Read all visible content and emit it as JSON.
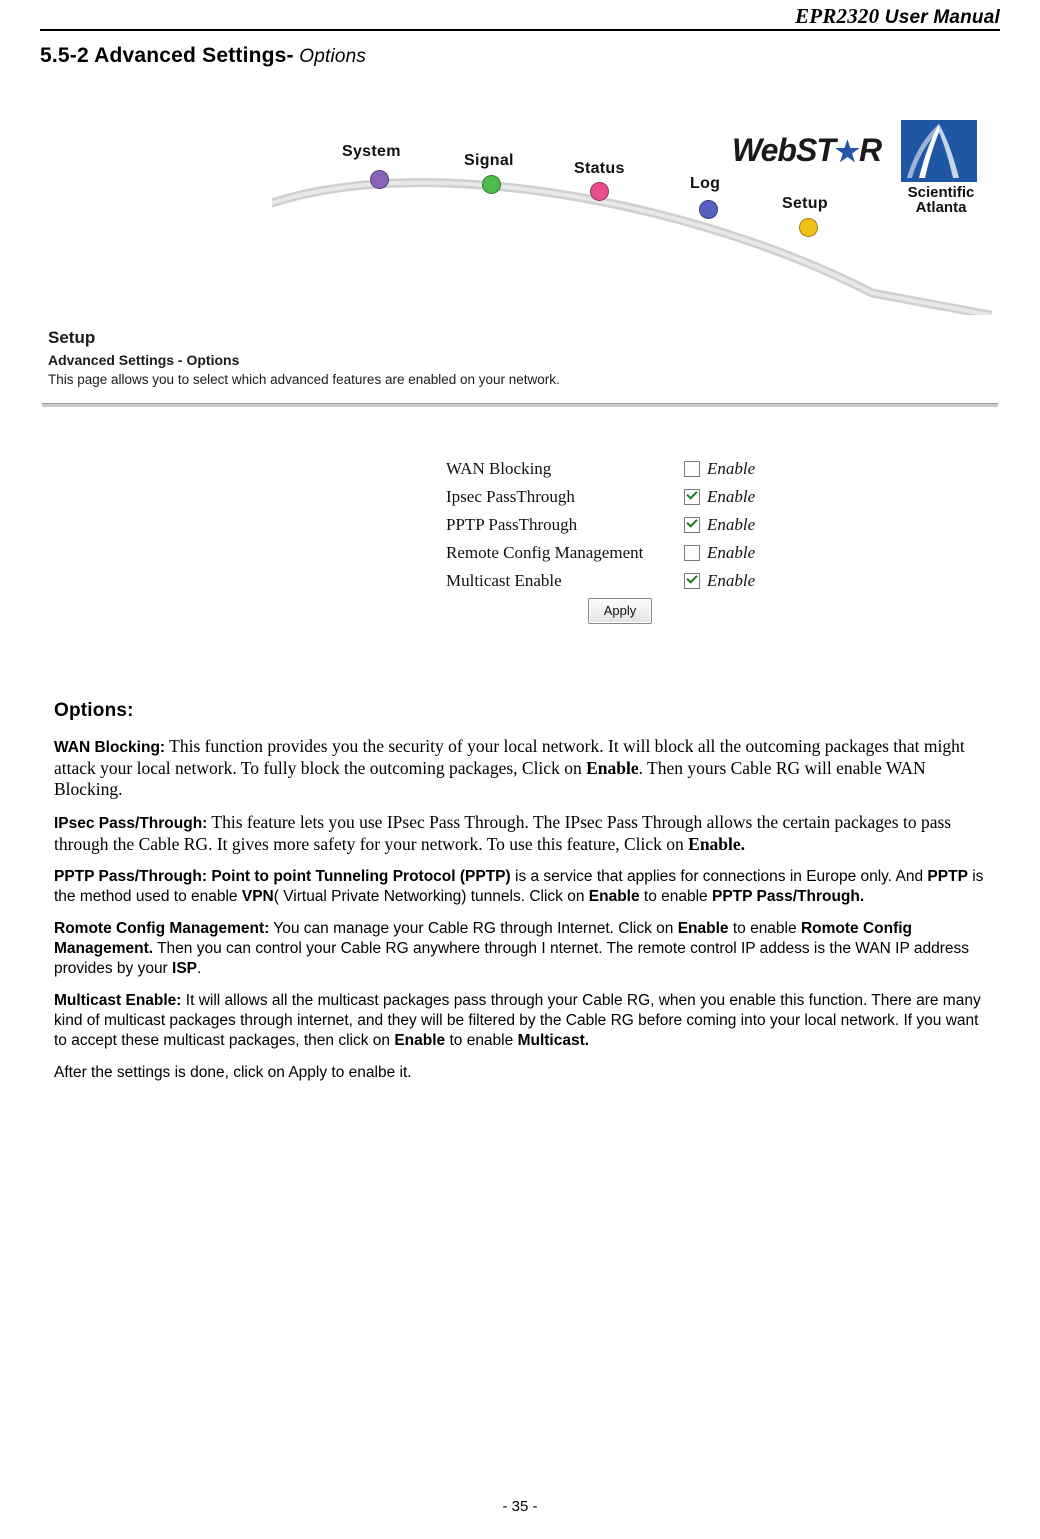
{
  "header": {
    "model": "EPR2320",
    "suffix": " User Manual"
  },
  "section": {
    "number_title": "5.5-2 Advanced Settings-",
    "italic_word": " Options"
  },
  "screenshot": {
    "nav": [
      {
        "label": "System",
        "color": "#8a63b8"
      },
      {
        "label": "Signal",
        "color": "#4dbb4d"
      },
      {
        "label": "Status",
        "color": "#e84d90"
      },
      {
        "label": "Log",
        "color": "#5560c0"
      },
      {
        "label": "Setup",
        "color": "#f2c21a"
      }
    ],
    "brand": {
      "webstar": "WebST",
      "webstar_tail": "R",
      "scientific": "Scientific",
      "atlanta": "Atlanta"
    },
    "setup": {
      "title": "Setup",
      "subtitle": "Advanced Settings - Options",
      "description": "This page allows you to select which advanced features are enabled on your network."
    },
    "form": {
      "rows": [
        {
          "label": "WAN Blocking",
          "checked": false,
          "enable_text": "Enable"
        },
        {
          "label": "Ipsec PassThrough",
          "checked": true,
          "enable_text": "Enable"
        },
        {
          "label": "PPTP PassThrough",
          "checked": true,
          "enable_text": "Enable"
        },
        {
          "label": "Remote Config Management",
          "checked": false,
          "enable_text": "Enable"
        },
        {
          "label": "Multicast Enable",
          "checked": true,
          "enable_text": "Enable"
        }
      ],
      "apply_label": "Apply"
    }
  },
  "content": {
    "heading": "Options:",
    "wan_blocking": {
      "label": "WAN Blocking:",
      "text_1": "   This function provides you the security of your local network. It will block all the outcoming packages that might attack your local network. To fully block the outcoming packages, Click on ",
      "bold_1": "Enable",
      "text_2": ".    Then yours Cable RG will enable WAN Blocking."
    },
    "ipsec": {
      "label": "IPsec Pass/Through:",
      "text_1": "   This feature lets you use IPsec Pass Through. The IPsec Pass Through allows the certain packages to pass through the Cable RG. It gives more safety for your network. To use this feature, Click on ",
      "bold_1": "Enable."
    },
    "pptp": {
      "label": "PPTP Pass/Through:",
      "bold_1": "   Point to point Tunneling Protocol (PPTP)",
      "text_1": " is a service that applies for connections in Europe only. And ",
      "bold_2": "PPTP",
      "text_2": " is the method used to enable ",
      "bold_3": "VPN",
      "text_3": "( Virtual Private Networking) tunnels. Click on ",
      "bold_4": "Enable",
      "text_4": " to enable ",
      "bold_5": "PPTP Pass/Through."
    },
    "remote": {
      "label": "Romote Config Management:",
      "text_1": " You can manage your Cable RG through Internet. Click on ",
      "bold_1": "Enable",
      "text_2": " to enable ",
      "bold_2": "Romote Config Management.",
      "text_3": " Then you can control your Cable RG anywhere through I nternet. The remote control IP addess is the WAN IP address provides by your ",
      "bold_3": "ISP",
      "text_4": "."
    },
    "multicast": {
      "label": "Multicast Enable:",
      "text_1": " It will allows all the multicast packages pass through your Cable RG, when you enable this function. There are many kind of multicast packages through internet, and they will be filtered by the Cable RG before coming into your local network. If you want to accept these multicast packages, then click on ",
      "bold_1": "Enable",
      "text_2": " to enable ",
      "bold_2": "Multicast."
    },
    "closing": "After the settings is done, click on Apply to enalbe it."
  },
  "footer": {
    "page_number": "- 35 -"
  }
}
